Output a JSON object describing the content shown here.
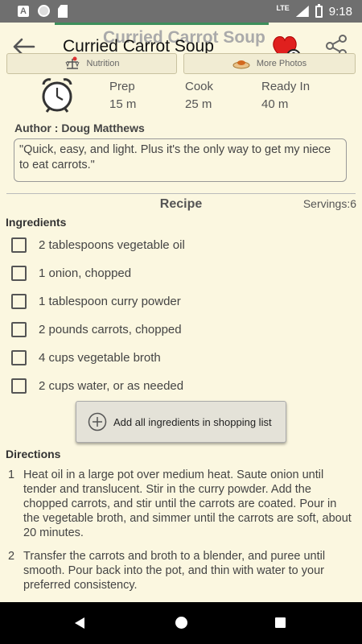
{
  "status_bar": {
    "network": "LTE",
    "time": "9:18"
  },
  "header": {
    "ghost_title": "Curried Carrot Soup",
    "title": "Curried Carrot Soup",
    "tabs": [
      {
        "label": "Nutrition",
        "icon": "scale-icon"
      },
      {
        "label": "More Photos",
        "icon": "plate-icon"
      }
    ]
  },
  "times": [
    {
      "label": "Prep",
      "value": "15 m"
    },
    {
      "label": "Cook",
      "value": "25 m"
    },
    {
      "label": "Ready In",
      "value": "40 m"
    }
  ],
  "author": "Author : Doug Matthews",
  "description": "\"Quick, easy, and light. Plus it's the only way to get my niece to eat carrots.\"",
  "recipe": {
    "heading": "Recipe",
    "servings": "Servings:6",
    "ingredients_heading": "Ingredients",
    "ingredients": [
      "2 tablespoons vegetable oil",
      "1 onion, chopped",
      "1 tablespoon curry powder",
      "2 pounds carrots, chopped",
      "4 cups vegetable broth",
      "2 cups water, or as needed"
    ],
    "add_button": "Add all ingredients in shopping list",
    "directions_heading": "Directions",
    "directions": [
      {
        "num": "1",
        "text": "Heat oil in a large pot over medium heat. Saute onion until tender and translucent. Stir in the curry powder. Add the chopped carrots, and stir until the carrots are coated. Pour in the vegetable broth, and simmer until the carrots are soft, about 20 minutes."
      },
      {
        "num": "2",
        "text": "Transfer the carrots and broth to a blender, and puree until smooth. Pour back into the pot, and thin with water to your preferred consistency."
      }
    ]
  },
  "colors": {
    "background": "#fbf7e0",
    "heart": "#e0201e",
    "status_bar": "#6f6f6f"
  }
}
